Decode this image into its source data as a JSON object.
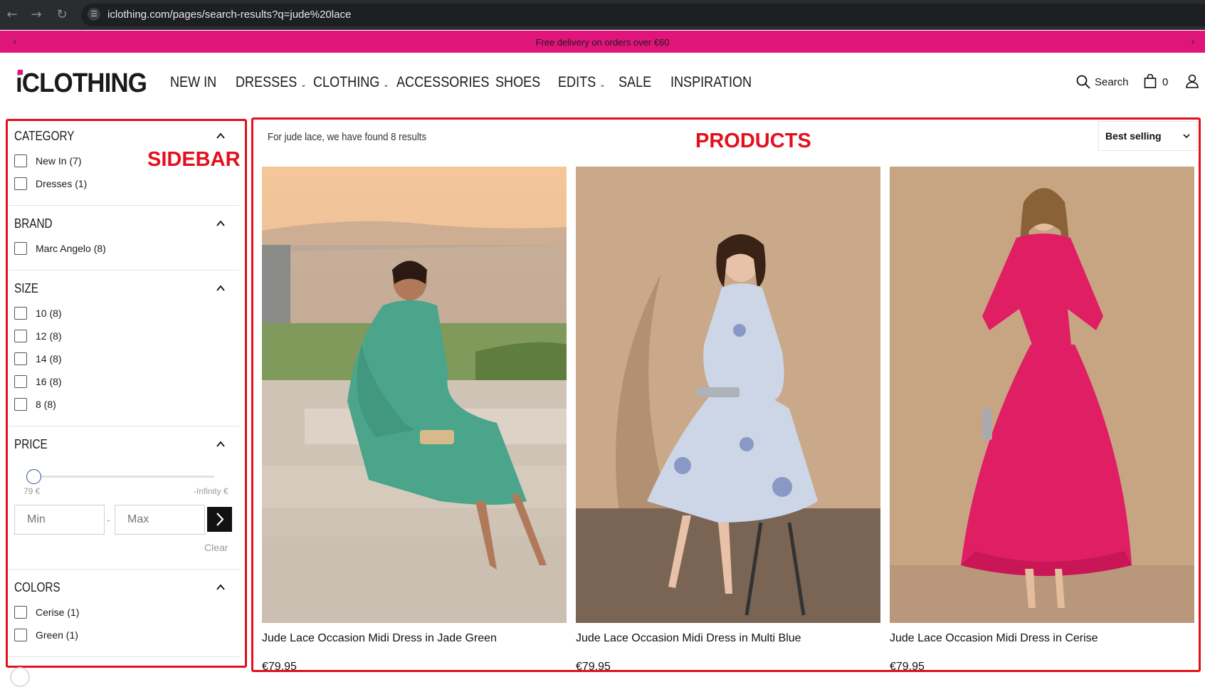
{
  "browser": {
    "url": "iclothing.com/pages/search-results?q=jude%20lace",
    "back_icon": "arrow-left-icon",
    "forward_icon": "arrow-right-icon",
    "reload_icon": "reload-icon"
  },
  "announcement": {
    "text": "Free delivery on orders over €60"
  },
  "header": {
    "logo": "iCLOTHING",
    "nav": [
      {
        "label": "NEW IN"
      },
      {
        "label": "DRESSES"
      },
      {
        "label": "CLOTHING"
      },
      {
        "label": "ACCESSORIES"
      },
      {
        "label": "SHOES"
      },
      {
        "label": "EDITS"
      },
      {
        "label": "SALE"
      },
      {
        "label": "INSPIRATION"
      }
    ],
    "search_label": "Search",
    "bag_count": "0"
  },
  "annotations": {
    "sidebar": "SIDEBAR",
    "products": "PRODUCTS"
  },
  "sidebar": {
    "category": {
      "title": "CATEGORY",
      "options": [
        "New In (7)",
        "Dresses (1)"
      ]
    },
    "brand": {
      "title": "BRAND",
      "options": [
        "Marc Angelo (8)"
      ]
    },
    "size": {
      "title": "SIZE",
      "options": [
        "10 (8)",
        "12 (8)",
        "14 (8)",
        "16 (8)",
        "8 (8)"
      ]
    },
    "price": {
      "title": "PRICE",
      "min_label": "79 €",
      "max_label": "-Infinity €",
      "min_placeholder": "Min",
      "max_placeholder": "Max",
      "separator": "-",
      "clear": "Clear"
    },
    "colors": {
      "title": "COLORS",
      "options": [
        "Cerise (1)",
        "Green (1)"
      ]
    }
  },
  "products": {
    "results_text": "For jude lace, we have found 8 results",
    "sort_value": "Best selling",
    "items": [
      {
        "name": "Jude Lace Occasion Midi Dress in Jade Green",
        "price": "€79.95",
        "dress_color": "#4aa58a"
      },
      {
        "name": "Jude Lace Occasion Midi Dress in Multi Blue",
        "price": "€79.95",
        "dress_color": "#cdd6e6"
      },
      {
        "name": "Jude Lace Occasion Midi Dress in Cerise",
        "price": "€79.95",
        "dress_color": "#e01e63"
      }
    ]
  },
  "colors": {
    "brand_pink": "#e0157c",
    "annotation_red": "#e3101c"
  }
}
